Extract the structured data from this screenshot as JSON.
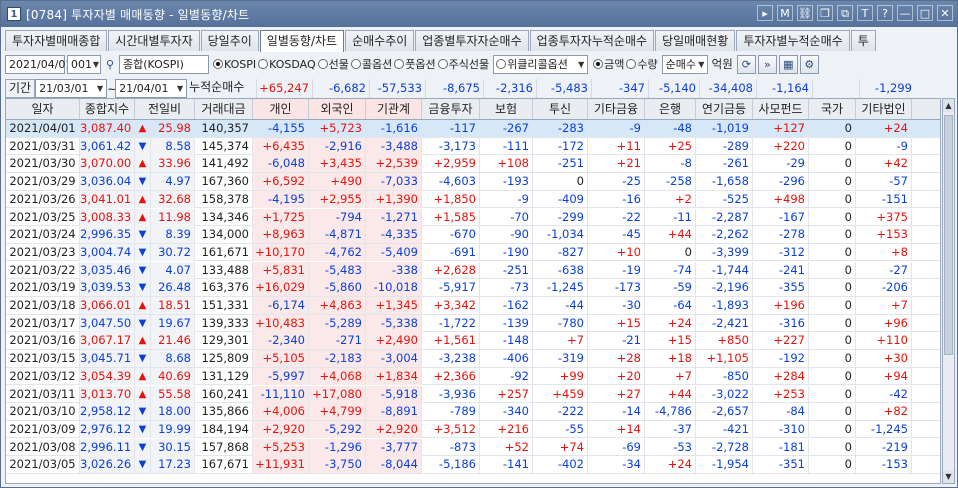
{
  "window": {
    "code": "[0784]",
    "title": "투자자별 매매동향 - 일별동향/차트",
    "icon_label": "1",
    "buttons": [
      "menu-icon",
      "M",
      "link-icon",
      "copy-icon",
      "screen-icon",
      "T",
      "?",
      "minimize-icon",
      "maximize-icon",
      "close-icon"
    ],
    "button_glyphs": [
      "▸",
      "M",
      "⛓",
      "❐",
      "⧉",
      "T",
      "?",
      "—",
      "□",
      "✕"
    ]
  },
  "tabs": [
    "투자자별매매종합",
    "시간대별투자자",
    "당일추이",
    "일별동향/차트",
    "순매수추이",
    "업종별투자자순매수",
    "업종투자자누적순매수",
    "당일매매현황",
    "투자자별누적순매수",
    "투"
  ],
  "active_tab": 3,
  "toolbar": {
    "date": "2021/04/01",
    "code": "001",
    "market": "종합(KOSPI)",
    "markets": [
      {
        "label": "KOSPI",
        "on": true
      },
      {
        "label": "KOSDAQ",
        "on": false
      },
      {
        "label": "선물",
        "on": false
      },
      {
        "label": "콜옵션",
        "on": false
      },
      {
        "label": "풋옵션",
        "on": false
      },
      {
        "label": "주식선물",
        "on": false
      }
    ],
    "weekly_option": "위클리콜옵션",
    "units": [
      {
        "label": "금액",
        "on": true
      },
      {
        "label": "수량",
        "on": false
      }
    ],
    "mode": "순매수",
    "unit_label": "억원"
  },
  "summary": {
    "label": "기간",
    "from": "21/03/01",
    "tilde": "~",
    "to": "21/04/01",
    "cum_label": "누적순매수",
    "values": [
      "+65,247",
      "-6,682",
      "-57,533",
      "-8,675",
      "-2,316",
      "-5,483",
      "-347",
      "-5,140",
      "-34,408",
      "-1,164",
      "",
      "-1,299"
    ]
  },
  "columns": [
    "일자",
    "종합지수",
    "전일비",
    "거래대금",
    "개인",
    "외국인",
    "기관계",
    "금융투자",
    "보험",
    "투신",
    "기타금융",
    "은행",
    "연기금등",
    "사모펀드",
    "국가",
    "기타법인"
  ],
  "rows": [
    [
      "2021/04/01",
      "3,087.40",
      "up",
      "25.98",
      "140,357",
      "-4,155",
      "+5,723",
      "-1,616",
      "-117",
      "-267",
      "-283",
      "-9",
      "-48",
      "-1,019",
      "+127",
      "0",
      "+24"
    ],
    [
      "2021/03/31",
      "3,061.42",
      "down",
      "8.58",
      "145,374",
      "+6,435",
      "-2,916",
      "-3,488",
      "-3,173",
      "-111",
      "-172",
      "+11",
      "+25",
      "-289",
      "+220",
      "0",
      "-9"
    ],
    [
      "2021/03/30",
      "3,070.00",
      "up",
      "33.96",
      "141,492",
      "-6,048",
      "+3,435",
      "+2,539",
      "+2,959",
      "+108",
      "-251",
      "+21",
      "-8",
      "-261",
      "-29",
      "0",
      "+42"
    ],
    [
      "2021/03/29",
      "3,036.04",
      "down",
      "4.97",
      "167,360",
      "+6,592",
      "+490",
      "-7,033",
      "-4,603",
      "-193",
      "0",
      "-25",
      "-258",
      "-1,658",
      "-296",
      "0",
      "-57"
    ],
    [
      "2021/03/26",
      "3,041.01",
      "up",
      "32.68",
      "158,378",
      "-4,195",
      "+2,955",
      "+1,390",
      "+1,850",
      "-9",
      "-409",
      "-16",
      "+2",
      "-525",
      "+498",
      "0",
      "-151"
    ],
    [
      "2021/03/25",
      "3,008.33",
      "up",
      "11.98",
      "134,346",
      "+1,725",
      "-794",
      "-1,271",
      "+1,585",
      "-70",
      "-299",
      "-22",
      "-11",
      "-2,287",
      "-167",
      "0",
      "+375"
    ],
    [
      "2021/03/24",
      "2,996.35",
      "down",
      "8.39",
      "134,000",
      "+8,963",
      "-4,871",
      "-4,335",
      "-670",
      "-90",
      "-1,034",
      "-45",
      "+44",
      "-2,262",
      "-278",
      "0",
      "+153"
    ],
    [
      "2021/03/23",
      "3,004.74",
      "down",
      "30.72",
      "161,671",
      "+10,170",
      "-4,762",
      "-5,409",
      "-691",
      "-190",
      "-827",
      "+10",
      "0",
      "-3,399",
      "-312",
      "0",
      "+8"
    ],
    [
      "2021/03/22",
      "3,035.46",
      "down",
      "4.07",
      "133,488",
      "+5,831",
      "-5,483",
      "-338",
      "+2,628",
      "-251",
      "-638",
      "-19",
      "-74",
      "-1,744",
      "-241",
      "0",
      "-27"
    ],
    [
      "2021/03/19",
      "3,039.53",
      "down",
      "26.48",
      "163,376",
      "+16,029",
      "-5,860",
      "-10,018",
      "-5,917",
      "-73",
      "-1,245",
      "-173",
      "-59",
      "-2,196",
      "-355",
      "0",
      "-206"
    ],
    [
      "2021/03/18",
      "3,066.01",
      "up",
      "18.51",
      "151,331",
      "-6,174",
      "+4,863",
      "+1,345",
      "+3,342",
      "-162",
      "-44",
      "-30",
      "-64",
      "-1,893",
      "+196",
      "0",
      "+7"
    ],
    [
      "2021/03/17",
      "3,047.50",
      "down",
      "19.67",
      "139,333",
      "+10,483",
      "-5,289",
      "-5,338",
      "-1,722",
      "-139",
      "-780",
      "+15",
      "+24",
      "-2,421",
      "-316",
      "0",
      "+96"
    ],
    [
      "2021/03/16",
      "3,067.17",
      "up",
      "21.46",
      "129,301",
      "-2,340",
      "-271",
      "+2,490",
      "+1,561",
      "-148",
      "+7",
      "-21",
      "+15",
      "+850",
      "+227",
      "0",
      "+110"
    ],
    [
      "2021/03/15",
      "3,045.71",
      "down",
      "8.68",
      "125,809",
      "+5,105",
      "-2,183",
      "-3,004",
      "-3,238",
      "-406",
      "-319",
      "+28",
      "+18",
      "+1,105",
      "-192",
      "0",
      "+30"
    ],
    [
      "2021/03/12",
      "3,054.39",
      "up",
      "40.69",
      "131,129",
      "-5,997",
      "+4,068",
      "+1,834",
      "+2,366",
      "-92",
      "+99",
      "+20",
      "+7",
      "-850",
      "+284",
      "0",
      "+94"
    ],
    [
      "2021/03/11",
      "3,013.70",
      "up",
      "55.58",
      "160,241",
      "-11,110",
      "+17,080",
      "-5,918",
      "-3,936",
      "+257",
      "+459",
      "+27",
      "+44",
      "-3,022",
      "+253",
      "0",
      "-42"
    ],
    [
      "2021/03/10",
      "2,958.12",
      "down",
      "18.00",
      "135,866",
      "+4,006",
      "+4,799",
      "-8,891",
      "-789",
      "-340",
      "-222",
      "-14",
      "-4,786",
      "-2,657",
      "-84",
      "0",
      "+82"
    ],
    [
      "2021/03/09",
      "2,976.12",
      "down",
      "19.99",
      "184,194",
      "+2,920",
      "-5,292",
      "+2,920",
      "+3,512",
      "+216",
      "-55",
      "+14",
      "-37",
      "-421",
      "-310",
      "0",
      "-1,245"
    ],
    [
      "2021/03/08",
      "2,996.11",
      "down",
      "30.15",
      "157,868",
      "+5,253",
      "-1,296",
      "-3,777",
      "-873",
      "+52",
      "+74",
      "-69",
      "-53",
      "-2,728",
      "-181",
      "0",
      "-219"
    ],
    [
      "2021/03/05",
      "3,026.26",
      "down",
      "17.23",
      "167,671",
      "+11,931",
      "-3,750",
      "-8,044",
      "-5,186",
      "-141",
      "-402",
      "-34",
      "+24",
      "-1,954",
      "-351",
      "0",
      "-153"
    ]
  ],
  "arrow_glyphs": {
    "up": "▲",
    "down": "▼"
  },
  "colors": {
    "up": "#e8120c",
    "down": "#0a3fd8",
    "selected_row": "#d6e8f8"
  }
}
